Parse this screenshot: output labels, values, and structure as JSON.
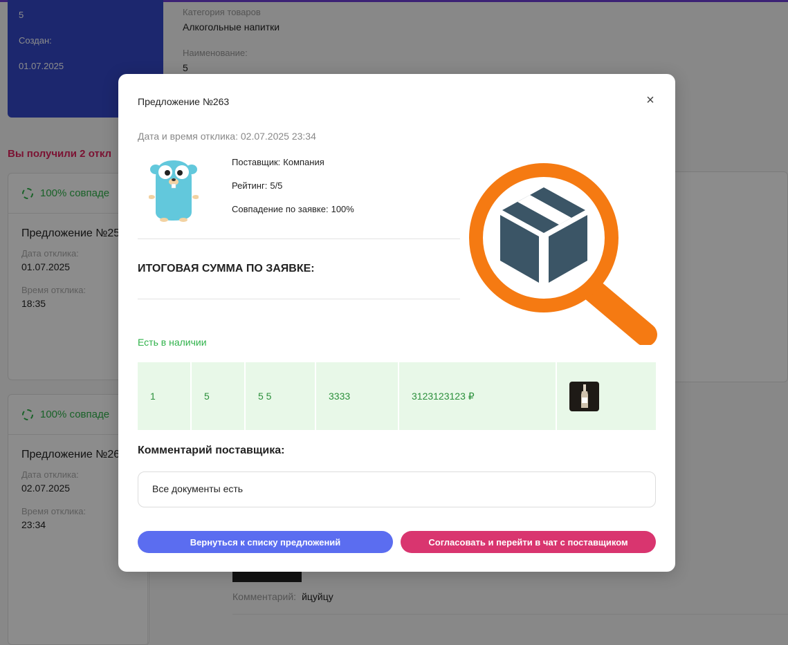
{
  "background": {
    "card_number": "5",
    "created_label": "Создан:",
    "created_date": "01.07.2025",
    "category_label": "Категория товаров",
    "category_value": "Алкогольные напитки",
    "name_label": "Наименование:",
    "name_value": "5",
    "received_text": "Вы получили 2 откл",
    "offers": [
      {
        "match": "100% совпаде",
        "title": "Предложение №25",
        "date_label": "Дата отклика:",
        "date": "01.07.2025",
        "time_label": "Время отклика:",
        "time": "18:35"
      },
      {
        "match": "100% совпаде",
        "title": "Предложение №26",
        "date_label": "Дата отклика:",
        "date": "02.07.2025",
        "time_label": "Время отклика:",
        "time": "23:34"
      }
    ],
    "comment_label": "Комментарий:",
    "comment_value": "йцуйцу"
  },
  "modal": {
    "title": "Предложение №263",
    "close_glyph": "×",
    "response_time": "Дата и время отклика: 02.07.2025 23:34",
    "supplier_label": "Поставщик:",
    "supplier_value": "Компания",
    "rating_label": "Рейтинг:",
    "rating_value": "5/5",
    "match_label": "Совпадение по заявке:",
    "match_value": "100%",
    "total_label": "ИТОГОВАЯ СУММА ПО ЗАЯВКЕ:",
    "in_stock": "Есть в наличии",
    "item_row": [
      "1",
      "5",
      "5 5",
      "3333",
      "3123123123 ₽"
    ],
    "comment_title": "Комментарий поставщика:",
    "comment_text": "Все документы есть",
    "back_button": "Вернуться к списку предложений",
    "agree_button": "Согласовать и перейти в чат с поставщиком"
  },
  "colors": {
    "accent_blue": "#5b6df0",
    "accent_pink": "#d9356f",
    "success_green": "#2fb24a",
    "logo_orange": "#f57a12",
    "logo_box": "#3b5566"
  },
  "icons": [
    "close-icon",
    "gopher-mascot",
    "search-box-logo",
    "bottle-thumbnail",
    "match-ring-icon"
  ]
}
